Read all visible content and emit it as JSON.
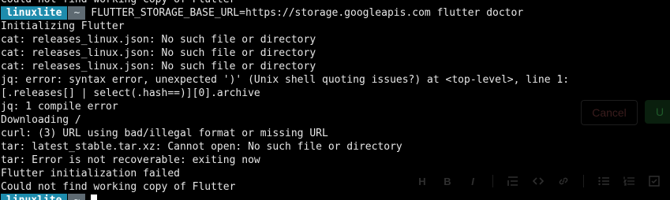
{
  "terminal": {
    "first_line_partial": "Could not find working copy of Flutter",
    "prompt": {
      "host": "linuxlite",
      "dir": "~",
      "command": "FLUTTER_STORAGE_BASE_URL=https://storage.googleapis.com flutter doctor"
    },
    "output": [
      "Initializing Flutter",
      "cat: releases_linux.json: No such file or directory",
      "cat: releases_linux.json: No such file or directory",
      "cat: releases_linux.json: No such file or directory",
      "jq: error: syntax error, unexpected ')' (Unix shell quoting issues?) at <top-level>, line 1:",
      "[.releases[] | select(.hash==)][0].archive",
      "jq: 1 compile error",
      "Downloading /",
      "curl: (3) URL using bad/illegal format or missing URL",
      "tar: latest_stable.tar.xz: Cannot open: No such file or directory",
      "tar: Error is not recoverable: exiting now",
      "Flutter initialization failed",
      "Could not find working copy of Flutter"
    ],
    "last_prompt": {
      "host": "linuxlite",
      "dir": "~"
    }
  },
  "background_app": {
    "cancel_label": "Cancel",
    "primary_label": "U",
    "toolbar_icons": [
      "heading-icon",
      "bold-icon",
      "italic-icon",
      "quote-icon",
      "code-icon",
      "link-icon",
      "bulleted-list-icon",
      "numbered-list-icon",
      "task-list-icon"
    ]
  },
  "colors": {
    "background": "#000000",
    "text": "#e6e6e6",
    "prompt_host_bg": "#1e8cad",
    "prompt_dir_bg": "#5e6a72"
  }
}
